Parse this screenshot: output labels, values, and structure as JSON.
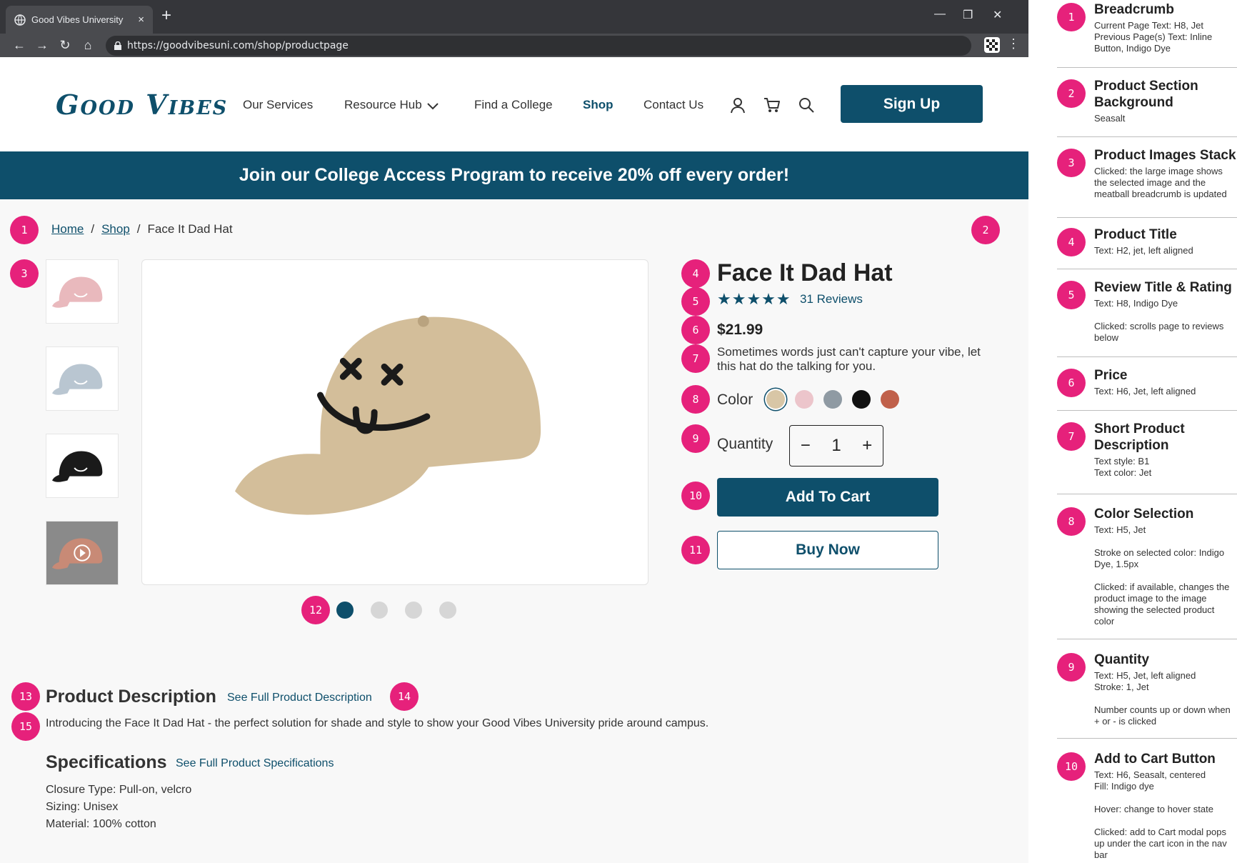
{
  "browser": {
    "tab_title": "Good Vibes University",
    "tab_close": "×",
    "new_tab": "+",
    "url": "https://goodvibesuni.com/shop/productpage"
  },
  "header": {
    "logo": "Good Vibes",
    "nav": [
      "Our Services",
      "Resource Hub",
      "Find a College",
      "Shop",
      "Contact Us"
    ],
    "signup_label": "Sign Up"
  },
  "promo": "Join our College Access Program to receive 20% off every order!",
  "breadcrumb": {
    "home": "Home",
    "shop": "Shop",
    "current": "Face It Dad Hat",
    "sep": "/"
  },
  "product": {
    "title": "Face It Dad Hat",
    "stars": "★★★★★",
    "rating": 5,
    "reviews": "31 Reviews",
    "price": "$21.99",
    "short_desc": "Sometimes words just can't capture your vibe, let this hat do the talking for you.",
    "color_label": "Color",
    "colors": [
      "#d8c6a6",
      "#ecc5cb",
      "#8f9aa3",
      "#111111",
      "#c0604a"
    ],
    "selected_color": 0,
    "quantity_label": "Quantity",
    "qty_minus": "−",
    "qty_value": "1",
    "qty_plus": "+",
    "add_to_cart": "Add To Cart",
    "buy_now": "Buy Now",
    "thumb_colors": [
      "#e9b9bd",
      "#b9c6d1",
      "#1a1a1a",
      "#c88a76"
    ],
    "main_color": "#d3be9a"
  },
  "description": {
    "title": "Product Description",
    "see_full": "See Full Product Description",
    "text": "Introducing the Face It Dad Hat - the perfect solution for shade and style to show your Good Vibes University pride around campus."
  },
  "specs": {
    "title": "Specifications",
    "see_full": "See Full Product Specifications",
    "items": [
      "Closure Type: Pull-on, velcro",
      "Sizing: Unisex",
      "Material: 100% cotton"
    ]
  },
  "markers": [
    "1",
    "2",
    "3",
    "4",
    "5",
    "6",
    "7",
    "8",
    "9",
    "10",
    "11",
    "12",
    "13",
    "14",
    "15"
  ],
  "notes": [
    {
      "n": "1",
      "title": "Breadcrumb",
      "desc": "Current Page Text: H8, Jet\nPrevious Page(s) Text: Inline Button, Indigo Dye"
    },
    {
      "n": "2",
      "title": "Product Section Background",
      "desc": "Seasalt"
    },
    {
      "n": "3",
      "title": "Product Images Stack",
      "desc": "Clicked: the large image shows the selected image and the meatball breadcrumb is updated"
    },
    {
      "n": "4",
      "title": "Product Title",
      "desc": "Text: H2, jet, left aligned"
    },
    {
      "n": "5",
      "title": "Review Title & Rating",
      "desc": "Text: H8, Indigo Dye\n\nClicked: scrolls page to reviews below"
    },
    {
      "n": "6",
      "title": "Price",
      "desc": "Text: H6, Jet, left aligned"
    },
    {
      "n": "7",
      "title": "Short Product Description",
      "desc": "Text style: B1\nText color: Jet"
    },
    {
      "n": "8",
      "title": "Color Selection",
      "desc": "Text: H5, Jet\n\nStroke on selected color: Indigo Dye, 1.5px\n\nClicked: if available, changes the product image to the image showing the selected product color"
    },
    {
      "n": "9",
      "title": "Quantity",
      "desc": "Text: H5, Jet, left aligned\nStroke: 1, Jet\n\nNumber counts up or down when + or - is clicked"
    },
    {
      "n": "10",
      "title": "Add to Cart Button",
      "desc": "Text: H6, Seasalt, centered\nFill: Indigo dye\n\nHover: change to hover state\n\nClicked: add to Cart modal pops up under the cart icon in the nav bar"
    }
  ]
}
